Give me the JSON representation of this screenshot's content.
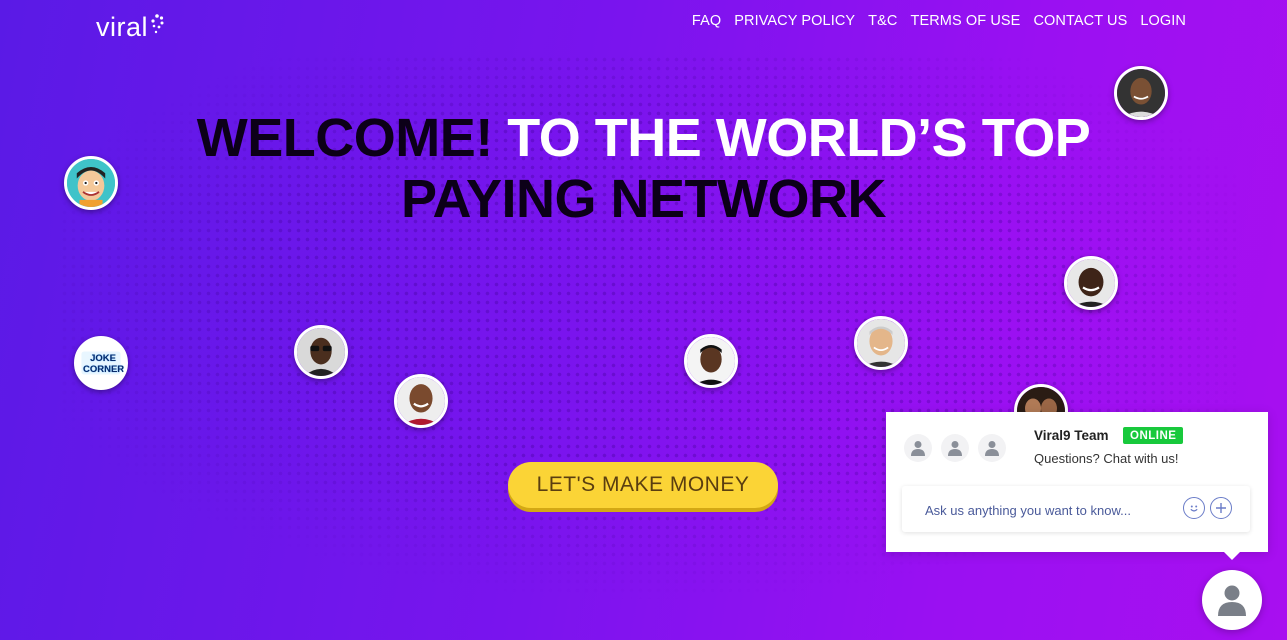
{
  "brand": {
    "logo_text": "viral"
  },
  "nav": {
    "items": [
      "FAQ",
      "PRIVACY POLICY",
      "T&C",
      "TERMS OF USE",
      "CONTACT US",
      "LOGIN"
    ]
  },
  "hero": {
    "headline_part1": "WELCOME!",
    "headline_part2": " TO THE WORLD’S TOP",
    "headline_line2": "PAYING NETWORK",
    "cta_label": "LET'S MAKE MONEY"
  },
  "avatars": {
    "joke_corner_text": "JOKE CORNER"
  },
  "chat": {
    "team_name": "Viral9 Team",
    "status": "ONLINE",
    "subtitle": "Questions? Chat with us!",
    "input_placeholder": "Ask us anything you want to know...",
    "emoji_icon": "smiley-icon",
    "attach_icon": "plus-icon"
  },
  "colors": {
    "background_start": "#5a1ae6",
    "background_end": "#a80ff0",
    "cta": "#fbd436",
    "online": "#18c93c"
  }
}
